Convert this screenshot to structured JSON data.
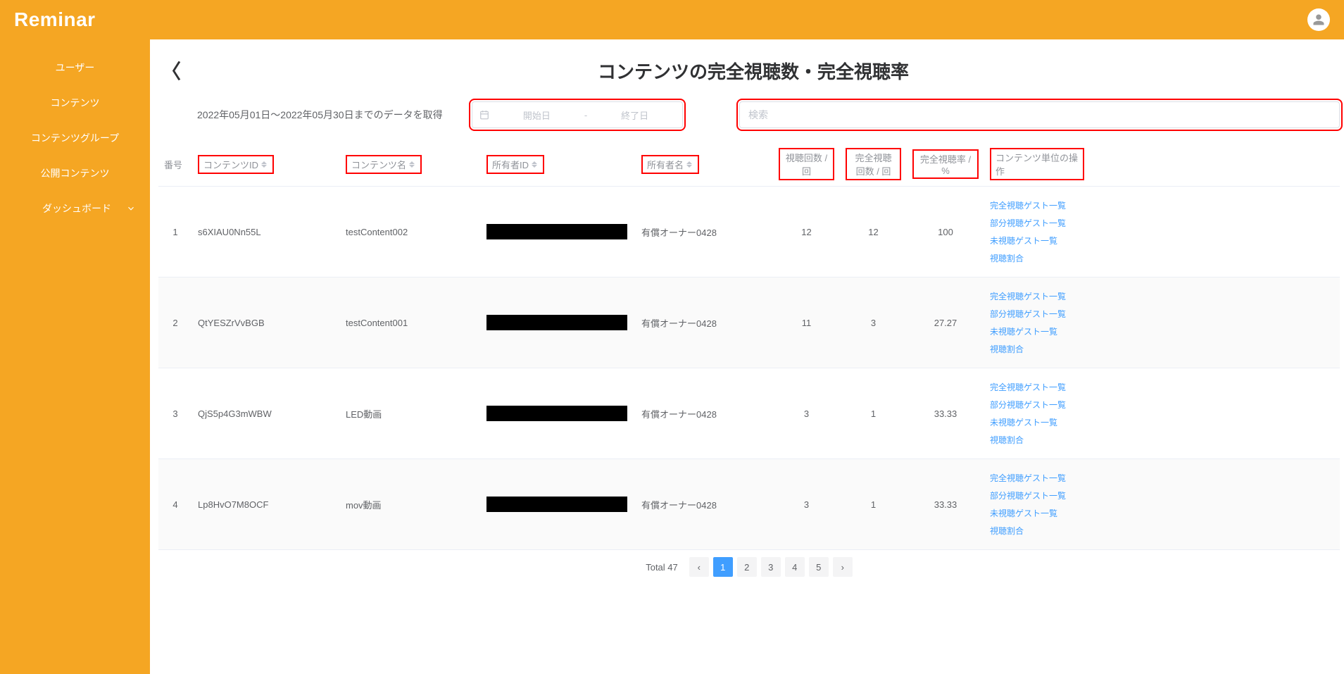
{
  "header": {
    "logo": "Reminar"
  },
  "sidebar": {
    "items": [
      {
        "label": "ユーザー"
      },
      {
        "label": "コンテンツ"
      },
      {
        "label": "コンテンツグループ"
      },
      {
        "label": "公開コンテンツ"
      },
      {
        "label": "ダッシュボード",
        "hasSub": true
      }
    ]
  },
  "page": {
    "title": "コンテンツの完全視聴数・完全視聴率",
    "dateRangeLabel": "2022年05月01日～2022年05月30日までのデータを取得",
    "datePicker": {
      "startPlaceholder": "開始日",
      "separator": "-",
      "endPlaceholder": "終了日"
    },
    "searchPlaceholder": "検索"
  },
  "table": {
    "headers": {
      "index": "番号",
      "contentId": "コンテンツID",
      "contentName": "コンテンツ名",
      "ownerId": "所有者ID",
      "ownerName": "所有者名",
      "views": "視聴回数 / 回",
      "completeViews": "完全視聴回数 / 回",
      "completeRate": "完全視聴率 / %",
      "ops": "コンテンツ単位の操作"
    },
    "opLabels": {
      "full": "完全視聴ゲスト一覧",
      "partial": "部分視聴ゲスト一覧",
      "none": "未視聴ゲスト一覧",
      "ratio": "視聴割合"
    },
    "rows": [
      {
        "index": "1",
        "contentId": "s6XIAU0Nn55L",
        "contentName": "testContent002",
        "ownerName": "有償オーナー0428",
        "views": "12",
        "completeViews": "12",
        "completeRate": "100"
      },
      {
        "index": "2",
        "contentId": "QtYESZrVvBGB",
        "contentName": "testContent001",
        "ownerName": "有償オーナー0428",
        "views": "11",
        "completeViews": "3",
        "completeRate": "27.27"
      },
      {
        "index": "3",
        "contentId": "QjS5p4G3mWBW",
        "contentName": "LED動画",
        "ownerName": "有償オーナー0428",
        "views": "3",
        "completeViews": "1",
        "completeRate": "33.33"
      },
      {
        "index": "4",
        "contentId": "Lp8HvO7M8OCF",
        "contentName": "mov動画",
        "ownerName": "有償オーナー0428",
        "views": "3",
        "completeViews": "1",
        "completeRate": "33.33"
      }
    ]
  },
  "pagination": {
    "totalLabel": "Total 47",
    "pages": [
      "1",
      "2",
      "3",
      "4",
      "5"
    ],
    "active": "1"
  }
}
